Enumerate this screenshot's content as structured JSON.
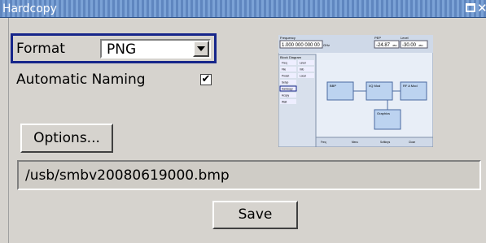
{
  "window": {
    "title": "Hardcopy"
  },
  "format": {
    "label": "Format",
    "value": "PNG"
  },
  "naming": {
    "label": "Automatic Naming",
    "checked": true,
    "check_glyph": "✔"
  },
  "buttons": {
    "options": "Options...",
    "save": "Save"
  },
  "filepath": "/usb/smbv20080619000.bmp",
  "preview": {
    "frequency_label": "Frequency",
    "frequency_value": "1.000 000 000 00",
    "frequency_unit": "GHz",
    "pep_label": "PEP",
    "level_label": "Level",
    "pep_value": "-24.87",
    "pep_unit": "dBm",
    "level_value": "-30.00",
    "level_unit": "dBm",
    "menu_title": "Block Diagram",
    "menu_items": [
      "Freq",
      "Level",
      "File",
      "Info",
      "Preset",
      "Local",
      "Setup",
      "Hardcopy",
      "Hcopy",
      "Wait"
    ],
    "bottom_tabs": [
      "Freq",
      "Menu",
      "Softkeys",
      "Close"
    ],
    "blocks": [
      "BBP",
      "I/Q Mod",
      "RF A Mod",
      "Graphics"
    ],
    "colors": {
      "screen": "#e8eef7",
      "header": "#cfd9e8",
      "blocks": "#bcd3f0"
    }
  }
}
